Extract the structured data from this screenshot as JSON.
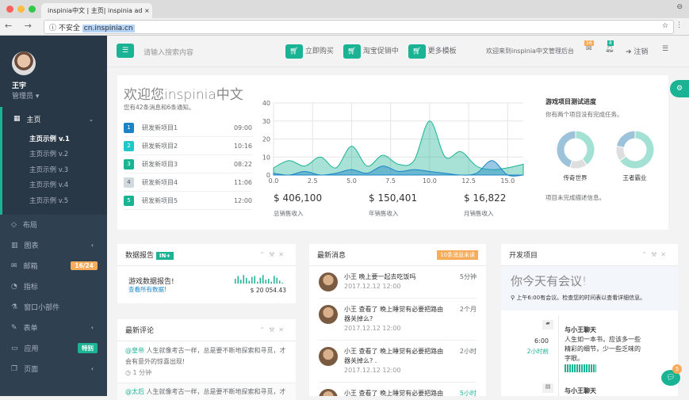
{
  "browser": {
    "tab_title": "inspinia中文 | 主页| inspinia ad",
    "security": "不安全",
    "url": "cn.inspinia.cn"
  },
  "sidebar": {
    "user_name": "王宇",
    "user_role": "管理员 ▾",
    "items": [
      {
        "label": "主页",
        "icon": "th-large-icon"
      },
      {
        "label": "布局",
        "icon": "diamond-icon"
      },
      {
        "label": "图表",
        "icon": "bar-chart-icon",
        "arrow": true
      },
      {
        "label": "邮箱",
        "icon": "envelope-icon",
        "badge": "16/24",
        "badge_color": "#f8ac59"
      },
      {
        "label": "指标",
        "icon": "pie-chart-icon"
      },
      {
        "label": "窗口小部件",
        "icon": "flask-icon"
      },
      {
        "label": "表单",
        "icon": "edit-icon",
        "arrow": true
      },
      {
        "label": "应用",
        "icon": "desktop-icon",
        "badge": "特别",
        "badge_color": "#1ab394"
      },
      {
        "label": "页面",
        "icon": "files-icon",
        "arrow": true
      }
    ],
    "subitems": [
      "主页示例 v.1",
      "主页示例 v.2",
      "主页示例 v.3",
      "主页示例 v.4",
      "主页示例 v.5"
    ]
  },
  "topbar": {
    "search_placeholder": "请输入搜索内容",
    "buttons": [
      "立即购买",
      "淘宝促销中",
      "更多模板"
    ],
    "welcome": "欢迎来到inspinia中文管理后台",
    "mail_count": "16",
    "bell_count": "8",
    "logout": "注销"
  },
  "welcome": {
    "title": "欢迎您inspinia中文",
    "subtitle": "您有42条消息和6条通知。",
    "tasks": [
      {
        "n": "1",
        "label": "研发新项目1",
        "time": "09:00",
        "color": "#1c84c6"
      },
      {
        "n": "2",
        "label": "研发新项目2",
        "time": "10:16",
        "color": "#23c6c8"
      },
      {
        "n": "3",
        "label": "研发新项目3",
        "time": "08:22",
        "color": "#1ab394"
      },
      {
        "n": "4",
        "label": "研发新项目4",
        "time": "11:06",
        "color": "#d1dade"
      },
      {
        "n": "5",
        "label": "研发新项目5",
        "time": "12:00",
        "color": "#1ab394"
      }
    ]
  },
  "chart_data": {
    "type": "area",
    "x": [
      0,
      1,
      2,
      3,
      4,
      5,
      6,
      7,
      8,
      9,
      10,
      11,
      12,
      13,
      14,
      15,
      16
    ],
    "xlim": [
      0,
      16
    ],
    "ylim": [
      0,
      40
    ],
    "xticks": [
      "0.0",
      "2.5",
      "5.0",
      "7.5",
      "10.0",
      "12.5",
      "15.0"
    ],
    "yticks": [
      "0",
      "10",
      "20",
      "30",
      "40"
    ],
    "series": [
      {
        "name": "series1",
        "color": "#1ab394",
        "values": [
          4,
          8,
          5,
          10,
          4,
          16,
          5,
          11,
          6,
          8,
          30,
          10,
          13,
          5,
          3,
          4,
          6
        ]
      },
      {
        "name": "series2",
        "color": "#1c84c6",
        "values": [
          1,
          0,
          2,
          0,
          1,
          3,
          1,
          5,
          2,
          3,
          2,
          1,
          0,
          1,
          8,
          0,
          0
        ]
      }
    ]
  },
  "stats": [
    {
      "value": "$ 406,100",
      "label": "总销售收入"
    },
    {
      "value": "$ 150,401",
      "label": "年销售收入"
    },
    {
      "value": "$ 16,822",
      "label": "月销售收入"
    }
  ],
  "progress": {
    "title": "游戏项目测试进度",
    "subtitle": "你有两个项目没有完成任务。",
    "footer": "项目未完成描述信息。",
    "donuts": [
      {
        "label": "传奇世界",
        "values": [
          40,
          15,
          45
        ]
      },
      {
        "label": "王者霸业",
        "values": [
          65,
          13,
          22
        ]
      }
    ],
    "colors": [
      "#a3e1d4",
      "#dedede",
      "#9cc3da"
    ]
  },
  "report": {
    "title": "数据报告",
    "badge": "IN+",
    "heading": "游戏数据报告!",
    "link": "查看所有数据!",
    "amount": "$ 20 054.43",
    "spark": [
      5,
      8,
      4,
      9,
      6,
      3,
      7,
      8,
      2,
      6,
      9,
      4,
      5,
      2,
      8,
      6,
      3,
      1
    ]
  },
  "comments": {
    "title": "最新评论",
    "items": [
      {
        "user": "@皇帝",
        "text": " 人生就像考古一样，总是要不断地探索和寻觅，才会有意外的惊喜出现!",
        "time": "1 分钟"
      },
      {
        "user": "@太后",
        "text": " 人生就像考古一样，总是要不断地探索和寻觅，才"
      }
    ]
  },
  "messages": {
    "title": "最新消息",
    "badge": "10条消息未读",
    "items": [
      {
        "text": "小王 晚上要一起去吃饭吗",
        "date": "2017.12.12 12:00",
        "ago": "5分钟"
      },
      {
        "text": "小王 查看了 晚上睡觉有必要把路由器关掉么?",
        "date": "2017.12.12 12:00",
        "ago": "2个月"
      },
      {
        "text": "小王 查看了 晚上睡觉有必要把路由器关掉么? .",
        "date": "2017.12.12 12:00",
        "ago": "2小时"
      },
      {
        "text": "小王 查看了 晚上睡觉有必要把路由器关掉",
        "date": "",
        "ago": "5小时"
      }
    ]
  },
  "dev": {
    "title": "开发项目",
    "meeting": "你今天有会议!",
    "meeting_info": "上午6:00有会议。检查您的时间表以查看详细信息。",
    "timeline": [
      {
        "time": "6:00",
        "ago": "2小时前",
        "title": "与小王聊天",
        "text": "人生如一本书，应该多一些精彩的细节，少一些乏味的字眼。"
      },
      {
        "title": "与小王聊天"
      }
    ],
    "chat_count": "5"
  }
}
